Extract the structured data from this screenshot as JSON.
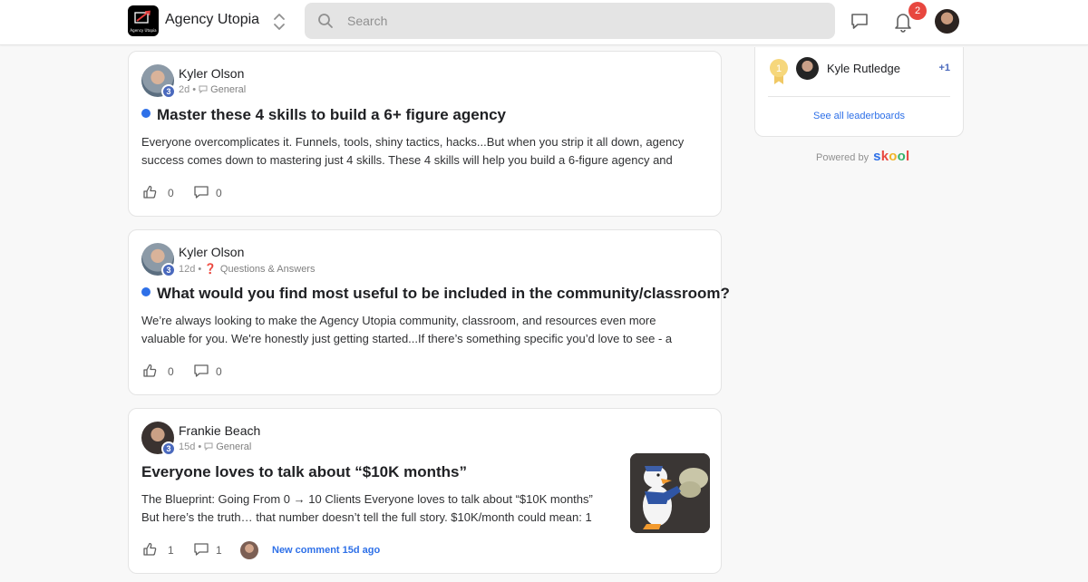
{
  "header": {
    "brand_name": "Agency Utopia",
    "logo_caption": "Agency Utopia",
    "search_placeholder": "Search",
    "notification_count": "2"
  },
  "posts": [
    {
      "author": "Kyler Olson",
      "level": "3",
      "age": "2d",
      "category": "General",
      "category_icon": "chat-icon",
      "unread": true,
      "title": "Master these 4 skills to build a 6+ figure agency",
      "body_line1": "Everyone overcomplicates it. Funnels, tools, shiny tactics, hacks...But when you strip it all down, agency",
      "body_line2": "success comes down to mastering just 4 skills. These 4 skills will help you build a 6-figure agency and",
      "likes": "0",
      "comments": "0"
    },
    {
      "author": "Kyler Olson",
      "level": "3",
      "age": "12d",
      "category": "Questions & Answers",
      "category_icon": "question-icon",
      "category_glyph": "❓",
      "unread": true,
      "title": "What would you find most useful to be included in the community/classroom?",
      "body_line1": "We’re always looking to make the Agency Utopia community, classroom, and resources even more",
      "body_line2": "valuable for you. We're honestly just getting started...If there’s something specific you’d love to see - a",
      "likes": "0",
      "comments": "0"
    },
    {
      "author": "Frankie Beach",
      "level": "3",
      "age": "15d",
      "category": "General",
      "category_icon": "chat-icon",
      "unread": false,
      "title": "Everyone loves to talk about “$10K months”",
      "body_line1": "The Blueprint: Going From 0 → 10 Clients Everyone loves to talk about “$10K months”",
      "body_line2": "But here’s the truth… that number doesn’t tell the full story. $10K/month could mean: 1",
      "likes": "1",
      "comments": "1",
      "new_comment": "New comment 15d ago",
      "thumbnail": "donald-duck-money-gif"
    }
  ],
  "leaderboard": {
    "rank": "1",
    "name": "Kyle Rutledge",
    "points": "+1",
    "link": "See all leaderboards"
  },
  "footer": {
    "powered_by": "Powered by",
    "brand_letters": [
      "s",
      "k",
      "o",
      "o",
      "l"
    ]
  },
  "colors": {
    "accent_blue": "#2e70e8",
    "badge_red": "#e8473f",
    "level_blue": "#4a69bd",
    "rank_gold": "#f0c864"
  }
}
